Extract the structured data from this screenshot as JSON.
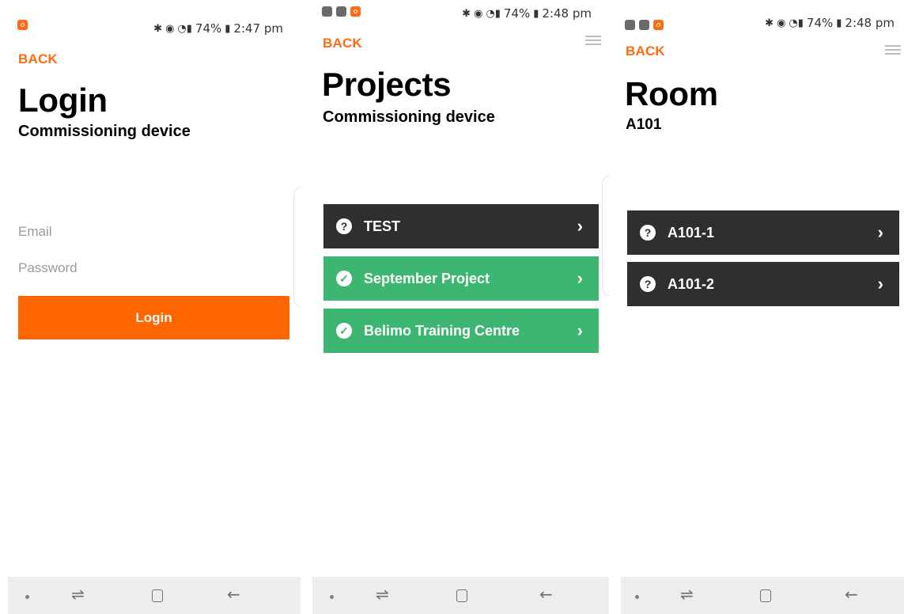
{
  "colors": {
    "accent": "#ff6600",
    "dark_row": "#2f2f2f",
    "success_row": "#3cb670",
    "placeholder": "#9a9a9a"
  },
  "screens": [
    {
      "status": {
        "notification_icons": [
          "app-icon"
        ],
        "battery": "74%",
        "time": "2:47 pm"
      },
      "back_label": "BACK",
      "title": "Login",
      "subtitle": "Commissioning device",
      "email_placeholder": "Email",
      "password_placeholder": "Password",
      "login_label": "Login"
    },
    {
      "status": {
        "notification_icons": [
          "message-icon",
          "image-icon",
          "app-icon"
        ],
        "battery": "74%",
        "time": "2:48 pm"
      },
      "back_label": "BACK",
      "title": "Projects",
      "subtitle": "Commissioning device",
      "items": [
        {
          "label": "TEST",
          "status": "unknown",
          "icon": "question-icon"
        },
        {
          "label": "September Project",
          "status": "complete",
          "icon": "check-icon"
        },
        {
          "label": "Belimo Training Centre",
          "status": "complete",
          "icon": "check-icon"
        }
      ]
    },
    {
      "status": {
        "notification_icons": [
          "image-icon",
          "message-icon",
          "app-icon"
        ],
        "battery": "74%",
        "time": "2:48 pm"
      },
      "back_label": "BACK",
      "title": "Room",
      "subtitle": "A101",
      "items": [
        {
          "label": "A101-1",
          "status": "unknown",
          "icon": "question-icon"
        },
        {
          "label": "A101-2",
          "status": "unknown",
          "icon": "question-icon"
        }
      ]
    }
  ]
}
